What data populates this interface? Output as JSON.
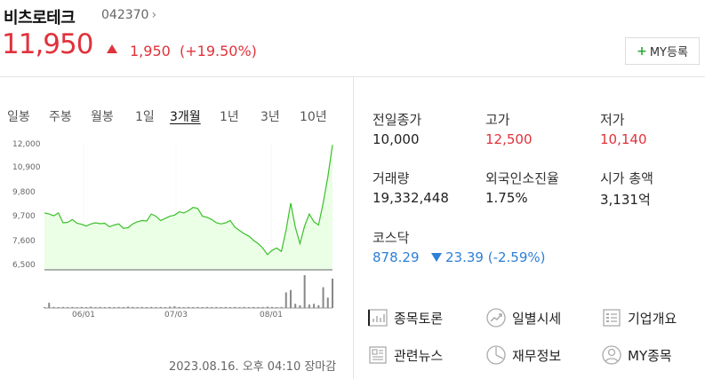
{
  "header": {
    "name": "비츠로테크",
    "code": "042370",
    "code_chevron": "›",
    "price": "11,950",
    "change": "1,950",
    "change_rate": "(+19.50%)",
    "my_button": "MY등록",
    "my_button_plus": "+"
  },
  "colors": {
    "up": "#e0323c",
    "down": "#2e7fd6",
    "line": "#3cbf2a",
    "fill": "#eaffe6"
  },
  "chart_tabs": [
    {
      "label": "일봉",
      "active": false
    },
    {
      "label": "주봉",
      "active": false
    },
    {
      "label": "월봉",
      "active": false
    },
    {
      "label": "1일",
      "active": false
    },
    {
      "label": "3개월",
      "active": true
    },
    {
      "label": "1년",
      "active": false
    },
    {
      "label": "3년",
      "active": false
    },
    {
      "label": "10년",
      "active": false
    }
  ],
  "chart_data": {
    "type": "area",
    "y_ticks": [
      "12,000",
      "10,900",
      "9,800",
      "9,700",
      "7,600",
      "6,500"
    ],
    "x_ticks": [
      "06/01",
      "07/03",
      "08/01"
    ],
    "ylim": [
      6500,
      12000
    ],
    "price_series": [
      8850,
      8800,
      8720,
      8850,
      8400,
      8420,
      8550,
      8380,
      8330,
      8250,
      8350,
      8400,
      8360,
      8380,
      8220,
      8300,
      8350,
      8150,
      8180,
      8350,
      8450,
      8500,
      8480,
      8800,
      8700,
      8500,
      8600,
      8700,
      8750,
      8900,
      8850,
      8950,
      9100,
      9050,
      8700,
      8650,
      8550,
      8400,
      8350,
      8400,
      8500,
      8200,
      8050,
      7900,
      7800,
      7600,
      7450,
      7250,
      6950,
      7150,
      7250,
      7100,
      8050,
      9300,
      8200,
      7450,
      8250,
      8800,
      8450,
      8300,
      9300,
      10500,
      11950
    ],
    "volume_series": [
      0.02,
      0.15,
      0.03,
      0.02,
      0.03,
      0.02,
      0.03,
      0.02,
      0.03,
      0.02,
      0.04,
      0.02,
      0.03,
      0.02,
      0.03,
      0.02,
      0.03,
      0.02,
      0.04,
      0.03,
      0.02,
      0.03,
      0.02,
      0.03,
      0.02,
      0.03,
      0.02,
      0.04,
      0.05,
      0.03,
      0.02,
      0.03,
      0.02,
      0.03,
      0.02,
      0.03,
      0.02,
      0.03,
      0.02,
      0.03,
      0.02,
      0.03,
      0.02,
      0.03,
      0.02,
      0.03,
      0.02,
      0.03,
      0.04,
      0.03,
      0.02,
      0.03,
      0.45,
      0.52,
      0.12,
      0.08,
      0.95,
      0.1,
      0.12,
      0.08,
      0.6,
      0.3,
      0.85
    ]
  },
  "updated": "2023.08.16. 오후 04:10 장마감",
  "stats": [
    {
      "label": "전일종가",
      "value": "10,000",
      "color": "normal"
    },
    {
      "label": "고가",
      "value": "12,500",
      "color": "red"
    },
    {
      "label": "저가",
      "value": "10,140",
      "color": "red"
    },
    {
      "label": "거래량",
      "value": "19,332,448",
      "color": "normal"
    },
    {
      "label": "외국인소진율",
      "value": "1.75%",
      "color": "normal"
    },
    {
      "label": "시가 총액",
      "value": "3,131억",
      "color": "normal"
    }
  ],
  "index": {
    "label": "코스닥",
    "value": "878.29",
    "change": "23.39",
    "change_rate": "(-2.59%)"
  },
  "links": [
    {
      "label": "종목토론",
      "icon": "chart-board-icon"
    },
    {
      "label": "일별시세",
      "icon": "trend-circle-icon"
    },
    {
      "label": "기업개요",
      "icon": "company-doc-icon"
    },
    {
      "label": "관련뉴스",
      "icon": "news-icon"
    },
    {
      "label": "재무정보",
      "icon": "pie-clock-icon"
    },
    {
      "label": "MY종목",
      "icon": "user-icon"
    }
  ]
}
